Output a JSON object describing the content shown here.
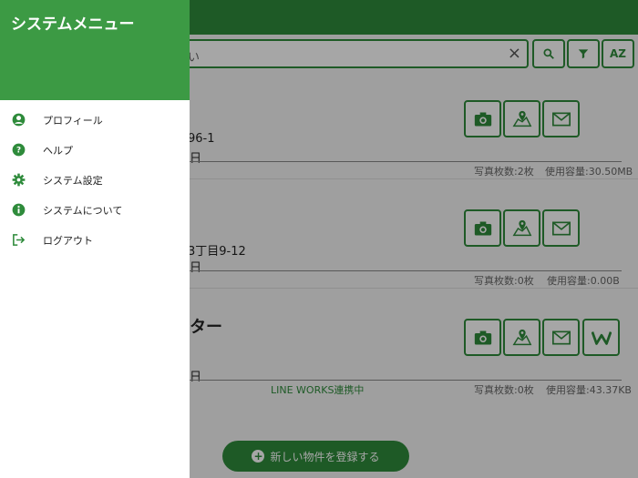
{
  "drawer": {
    "title": "システムメニュー",
    "items": [
      {
        "label": "プロフィール",
        "icon": "account-circle-icon"
      },
      {
        "label": "ヘルプ",
        "icon": "help-circle-icon"
      },
      {
        "label": "システム設定",
        "icon": "gear-icon"
      },
      {
        "label": "システムについて",
        "icon": "info-icon"
      },
      {
        "label": "ログアウト",
        "icon": "logout-icon"
      }
    ]
  },
  "search": {
    "placeholder": "い"
  },
  "cards": [
    {
      "title": "",
      "address": "96-1",
      "date": "日",
      "photo_count": "写真枚数:2枚",
      "storage": "使用容量:30.50MB",
      "lineworks": ""
    },
    {
      "title": "",
      "address": "3丁目9-12",
      "date": "日",
      "photo_count": "写真枚数:0枚",
      "storage": "使用容量:0.00B",
      "lineworks": ""
    },
    {
      "title": "ター",
      "address": "",
      "date": "日",
      "photo_count": "写真枚数:0枚",
      "storage": "使用容量:43.37KB",
      "lineworks": "LINE WORKS連携中"
    }
  ],
  "fab": {
    "label": "新しい物件を登録する"
  },
  "colors": {
    "brand": "#2e8b3b",
    "drawer_header": "#3c9a44"
  }
}
